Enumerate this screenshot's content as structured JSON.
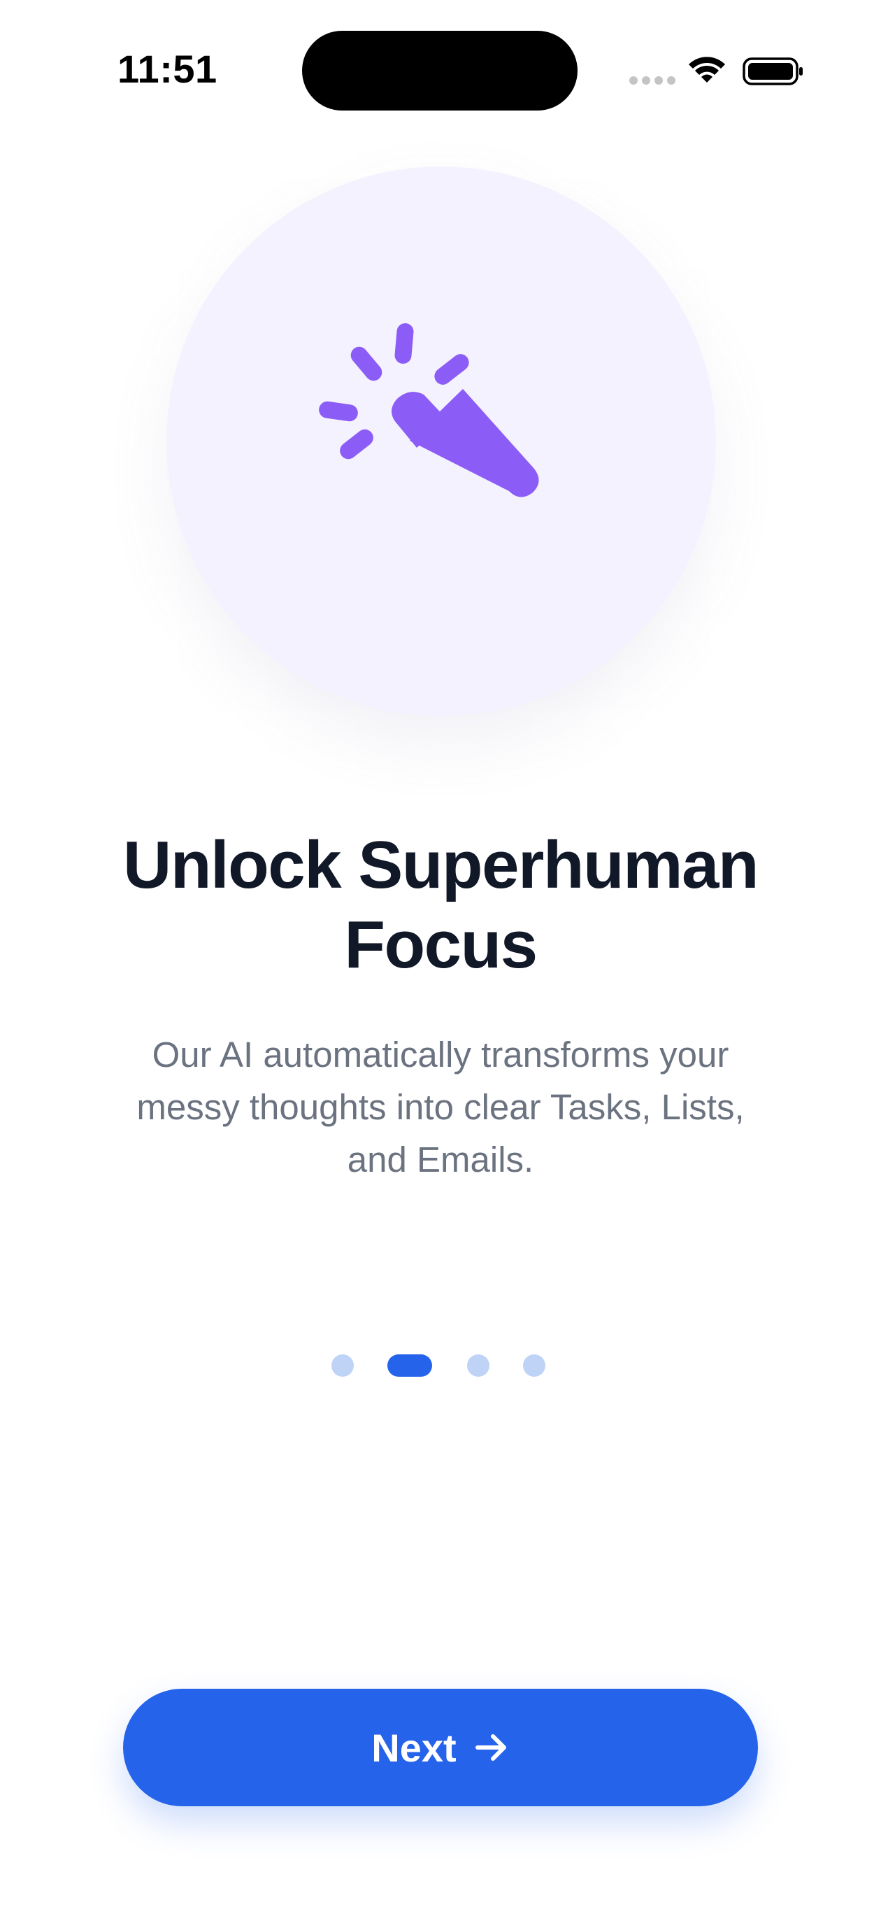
{
  "status_bar": {
    "time": "11:51",
    "icons": [
      "signal-icon",
      "wifi-icon",
      "battery-icon"
    ]
  },
  "hero": {
    "icon": "magic-wand-icon",
    "circle_color": "#f4f2fe",
    "icon_color": "#8b5cf6"
  },
  "onboarding": {
    "title": "Unlock Superhuman Focus",
    "subtitle": "Our AI automatically transforms your messy thoughts into clear Tasks, Lists, and Emails.",
    "page_count": 4,
    "current_page": 2
  },
  "actions": {
    "next_label": "Next",
    "next_icon": "arrow-right-icon"
  },
  "colors": {
    "accent": "#2563eb",
    "dot_inactive": "#bfd3f6",
    "title": "#111827",
    "subtitle": "#6b7280"
  }
}
